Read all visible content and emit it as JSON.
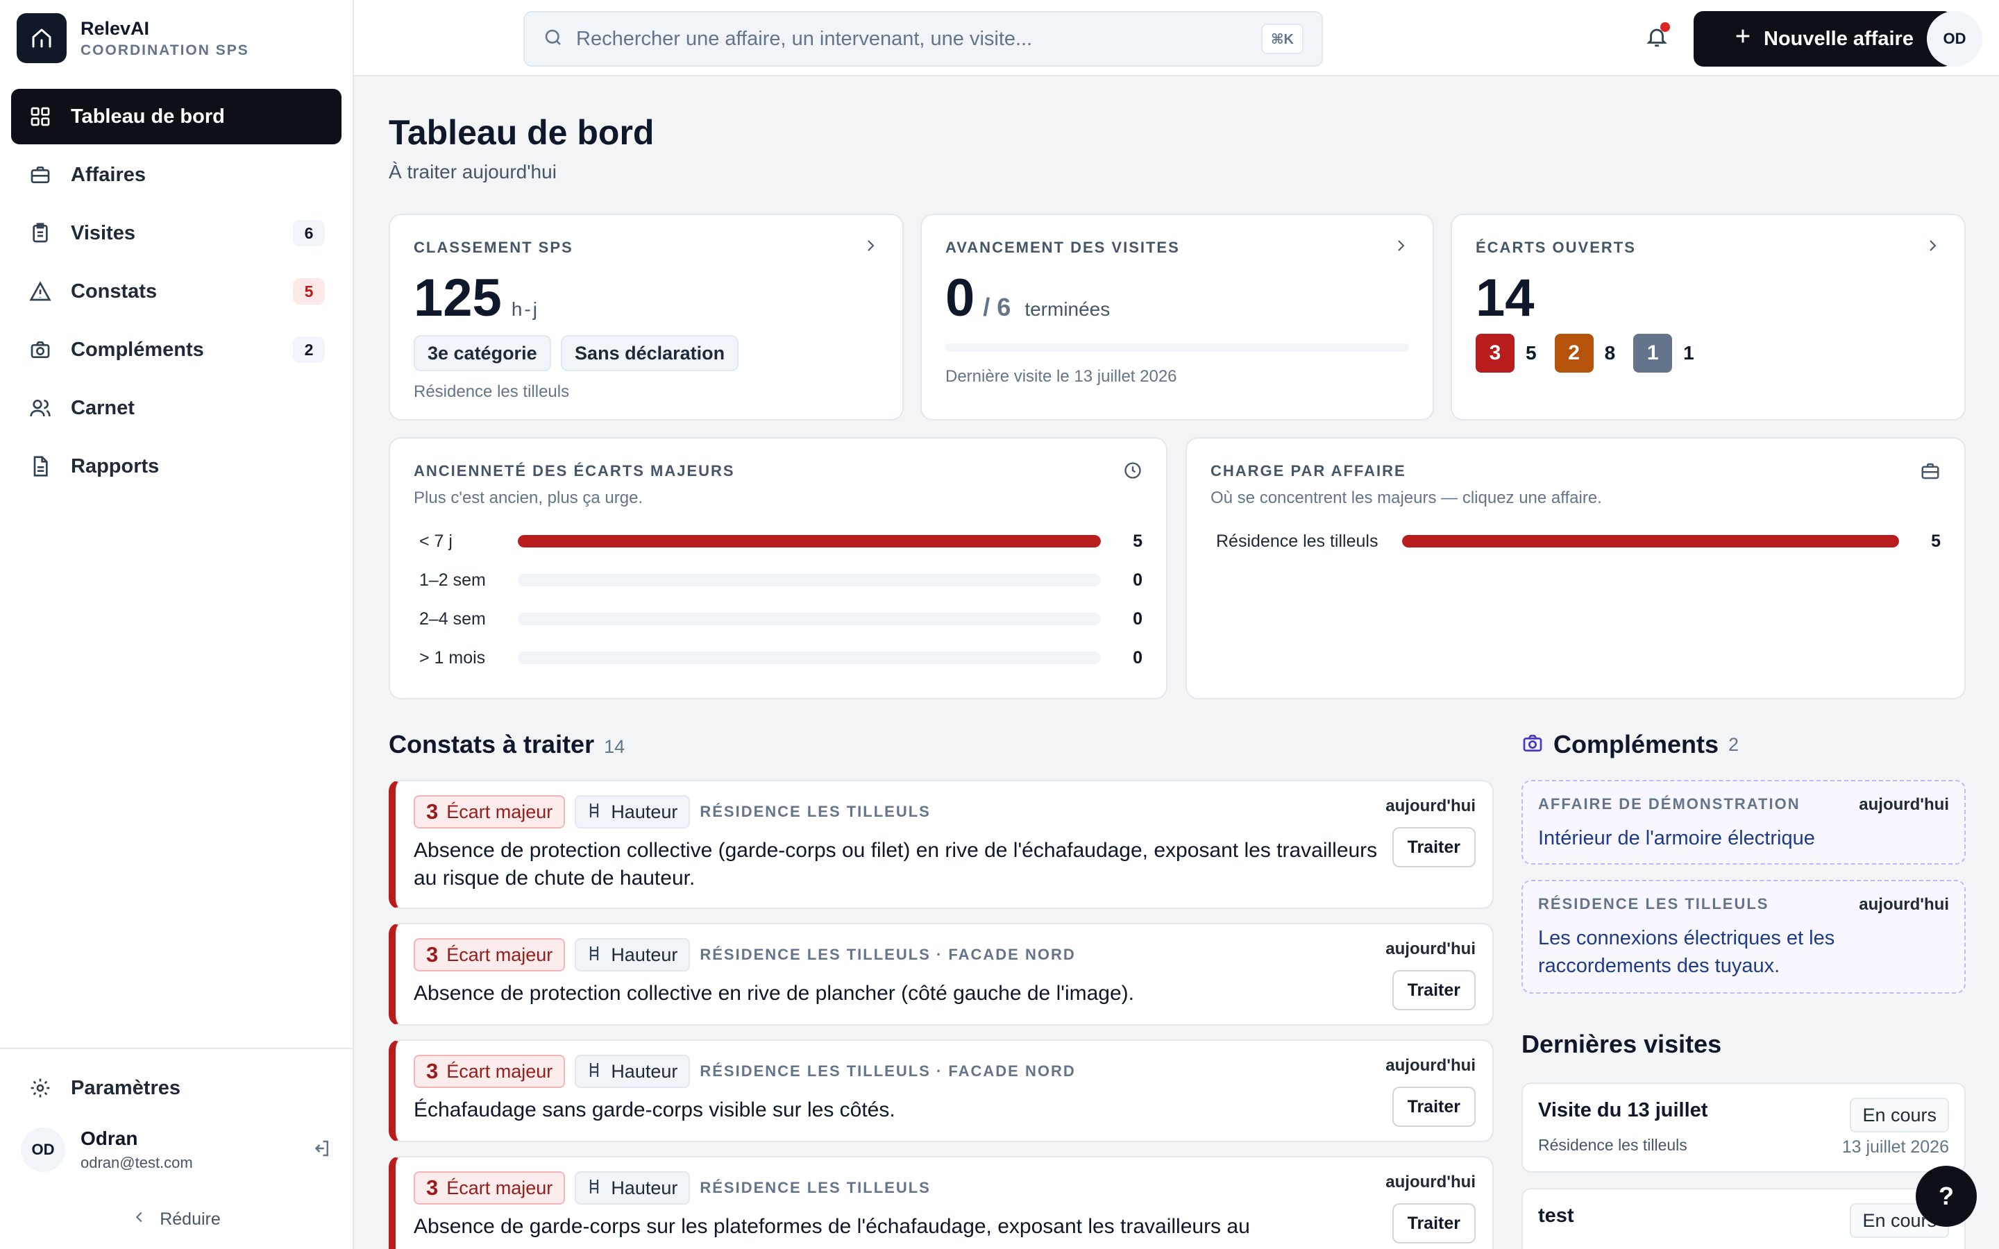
{
  "app": {
    "name": "RelevAI",
    "subtitle": "COORDINATION SPS"
  },
  "sidebar": {
    "items": [
      {
        "label": "Tableau de bord",
        "icon": "dashboard-icon",
        "active": true
      },
      {
        "label": "Affaires",
        "icon": "briefcase-icon"
      },
      {
        "label": "Visites",
        "icon": "clipboard-icon",
        "badge": "6"
      },
      {
        "label": "Constats",
        "icon": "warning-icon",
        "badge": "5"
      },
      {
        "label": "Compléments",
        "icon": "camera-icon",
        "badge": "2"
      },
      {
        "label": "Carnet",
        "icon": "users-icon"
      },
      {
        "label": "Rapports",
        "icon": "document-icon"
      }
    ],
    "settings_label": "Paramètres",
    "user": {
      "initials": "OD",
      "name": "Odran",
      "email": "odran@test.com"
    },
    "reduce_label": "Réduire"
  },
  "topbar": {
    "search_placeholder": "Rechercher une affaire, un intervenant, une visite...",
    "shortcut": "⌘K",
    "new_button": "Nouvelle affaire",
    "avatar": "OD"
  },
  "page": {
    "title": "Tableau de bord",
    "subtitle": "À traiter aujourd'hui"
  },
  "kpi": {
    "classement": {
      "label": "CLASSEMENT SPS",
      "value": "125",
      "unit": "h-j",
      "tags": [
        "3e catégorie",
        "Sans déclaration"
      ],
      "note": "Résidence les tilleuls"
    },
    "avancement": {
      "label": "AVANCEMENT DES VISITES",
      "done": "0",
      "total": "/ 6",
      "suffix": "terminées",
      "progress": 0,
      "note": "Dernière visite le 13 juillet 2026"
    },
    "ecarts": {
      "label": "ÉCARTS OUVERTS",
      "value": "14",
      "levels": [
        {
          "level": "3",
          "count": "5",
          "color": "#b91c1c"
        },
        {
          "level": "2",
          "count": "8",
          "color": "#b45309"
        },
        {
          "level": "1",
          "count": "1",
          "color": "#64748b"
        }
      ]
    }
  },
  "anciennete": {
    "title": "ANCIENNETÉ DES ÉCARTS MAJEURS",
    "subtitle": "Plus c'est ancien, plus ça urge.",
    "max": 5,
    "rows": [
      {
        "label": "< 7 j",
        "value": 5
      },
      {
        "label": "1–2 sem",
        "value": 0
      },
      {
        "label": "2–4 sem",
        "value": 0
      },
      {
        "label": "> 1 mois",
        "value": 0
      }
    ]
  },
  "charge": {
    "title": "CHARGE PAR AFFAIRE",
    "subtitle": "Où se concentrent les majeurs — cliquez une affaire.",
    "max": 5,
    "rows": [
      {
        "label": "Résidence les tilleuls",
        "value": 5
      }
    ]
  },
  "constats": {
    "title": "Constats à traiter",
    "count": "14",
    "items": [
      {
        "sev": "3",
        "sev_label": "Écart majeur",
        "cat": "Hauteur",
        "loc": "RÉSIDENCE LES TILLEULS",
        "date": "aujourd'hui",
        "action": "Traiter",
        "text": "Absence de protection collective (garde-corps ou filet) en rive de l'échafaudage, exposant les travailleurs au risque de chute de hauteur."
      },
      {
        "sev": "3",
        "sev_label": "Écart majeur",
        "cat": "Hauteur",
        "loc": "RÉSIDENCE LES TILLEULS · FACADE NORD",
        "date": "aujourd'hui",
        "action": "Traiter",
        "text": "Absence de protection collective en rive de plancher (côté gauche de l'image)."
      },
      {
        "sev": "3",
        "sev_label": "Écart majeur",
        "cat": "Hauteur",
        "loc": "RÉSIDENCE LES TILLEULS · FACADE NORD",
        "date": "aujourd'hui",
        "action": "Traiter",
        "text": "Échafaudage sans garde-corps visible sur les côtés."
      },
      {
        "sev": "3",
        "sev_label": "Écart majeur",
        "cat": "Hauteur",
        "loc": "RÉSIDENCE LES TILLEULS",
        "date": "aujourd'hui",
        "action": "Traiter",
        "text": "Absence de garde-corps sur les plateformes de l'échafaudage, exposant les travailleurs au"
      }
    ]
  },
  "complements": {
    "title": "Compléments",
    "count": "2",
    "items": [
      {
        "affaire": "AFFAIRE DE DÉMONSTRATION",
        "date": "aujourd'hui",
        "text": "Intérieur de l'armoire électrique"
      },
      {
        "affaire": "RÉSIDENCE LES TILLEULS",
        "date": "aujourd'hui",
        "text": "Les connexions électriques et les raccordements des tuyaux."
      }
    ]
  },
  "visites": {
    "title": "Dernières visites",
    "items": [
      {
        "title": "Visite du 13 juillet",
        "status": "En cours",
        "affaire": "Résidence les tilleuls",
        "date": "13 juillet 2026"
      },
      {
        "title": "test",
        "status": "En cours"
      }
    ]
  },
  "help": "?"
}
